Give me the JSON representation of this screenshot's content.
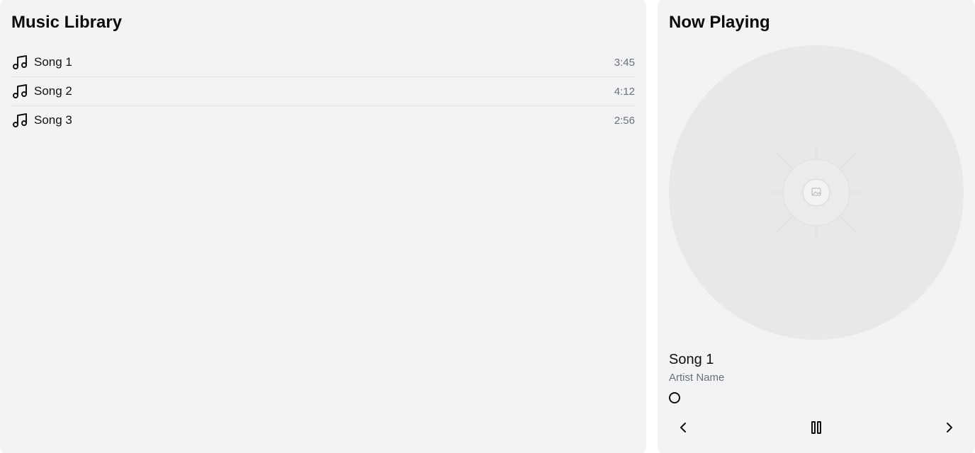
{
  "library": {
    "title": "Music Library",
    "songs": [
      {
        "title": "Song 1",
        "duration": "3:45",
        "icon": "music-note-icon"
      },
      {
        "title": "Song 2",
        "duration": "4:12",
        "icon": "music-note-icon"
      },
      {
        "title": "Song 3",
        "duration": "2:56",
        "icon": "music-note-icon"
      }
    ]
  },
  "now_playing": {
    "title": "Now Playing",
    "album_art_icon": "image-placeholder-icon",
    "track_title": "Song 1",
    "artist": "Artist Name",
    "progress": 0,
    "controls": {
      "previous_icon": "chevron-left-icon",
      "pause_icon": "pause-icon",
      "next_icon": "chevron-right-icon"
    }
  },
  "colors": {
    "panel_background": "#f2f3f5",
    "album_art_background": "#e8e8e8",
    "muted_text": "#6b6f76",
    "divider": "#e3e4e6"
  }
}
